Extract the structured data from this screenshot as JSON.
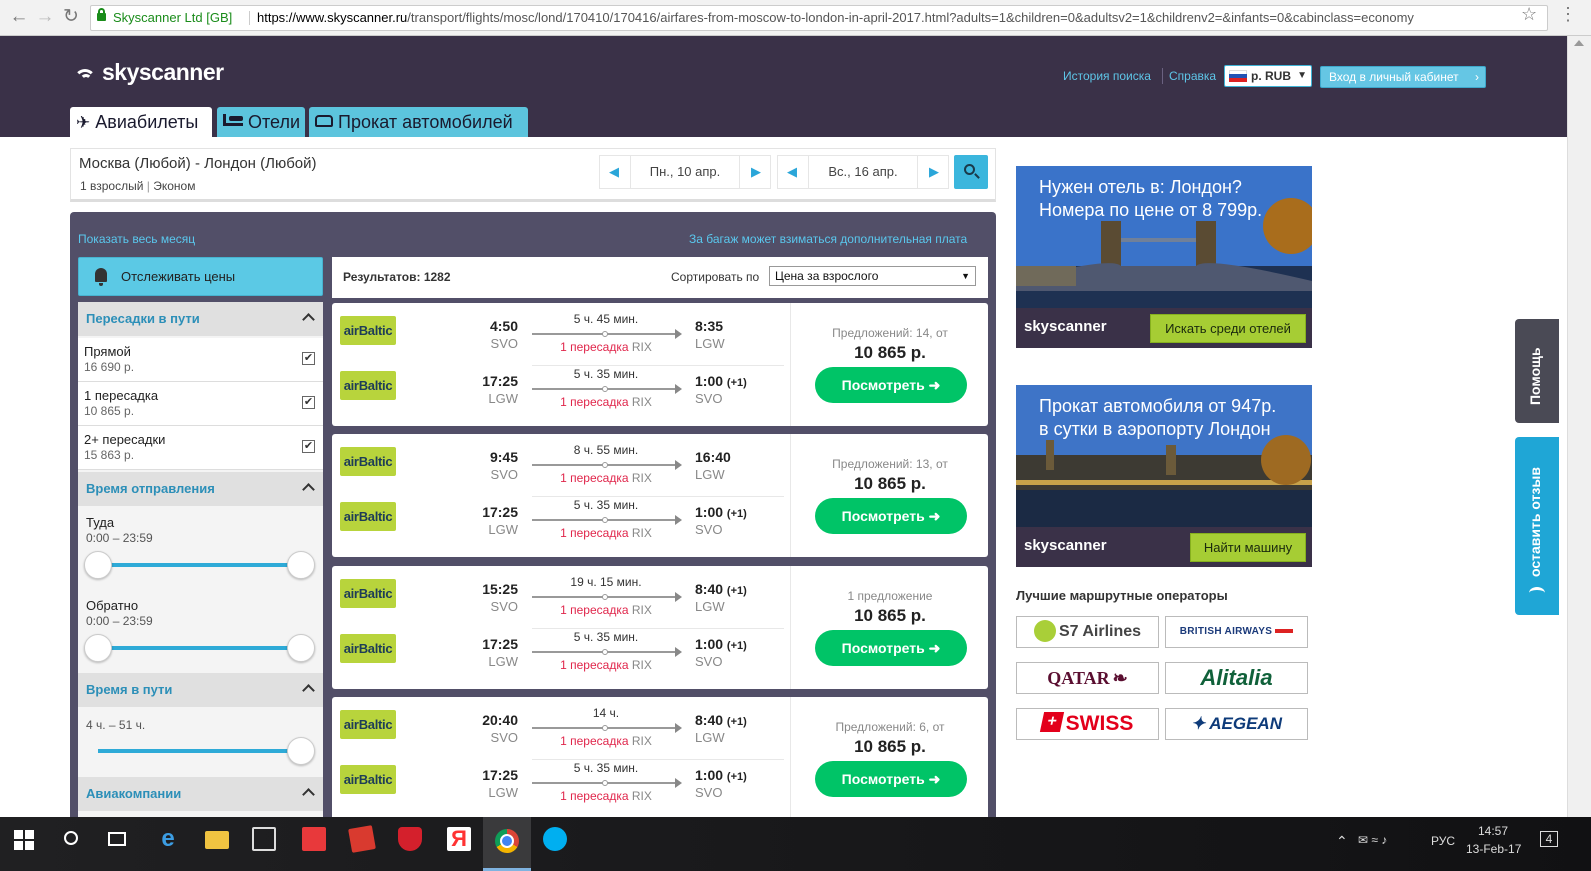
{
  "browser": {
    "site_identity": "Skyscanner Ltd [GB]",
    "url_host": "https://www.skyscanner.ru",
    "url_path": "/transport/flights/mosc/lond/170410/170416/airfares-from-moscow-to-london-in-april-2017.html?adults=1&children=0&adultsv2=1&childrenv2=&infants=0&cabinclass=economy"
  },
  "header": {
    "logo_text": "skyscanner",
    "search_history": "История поиска",
    "help": "Справка",
    "currency": "р. RUB",
    "login": "Вход в личный кабинет"
  },
  "tabs": [
    {
      "label": "Авиабилеты",
      "icon": "plane-icon"
    },
    {
      "label": "Отели",
      "icon": "bed-icon"
    },
    {
      "label": "Прокат автомобилей",
      "icon": "car-icon"
    }
  ],
  "search": {
    "route": "Москва (Любой) - Лондон (Любой)",
    "passengers": "1 взрослый",
    "cabin": "Эконом",
    "depart_date": "Пн., 10 апр.",
    "return_date": "Вс., 16 апр."
  },
  "results_bar": {
    "show_month": "Показать весь месяц",
    "baggage_note": "За багаж может взиматься дополнительная плата",
    "track_prices": "Отслеживать цены",
    "count_label": "Результатов: 1282",
    "sort_label": "Сортировать по",
    "sort_value": "Цена за взрослого"
  },
  "filters": {
    "stops_title": "Пересадки в пути",
    "stops": [
      {
        "name": "Прямой",
        "price": "16 690 р.",
        "checked": true
      },
      {
        "name": "1 пересадка",
        "price": "10 865 р.",
        "checked": true
      },
      {
        "name": "2+ пересадки",
        "price": "15 863 р.",
        "checked": true
      }
    ],
    "depart_title": "Время отправления",
    "outbound_label": "Туда",
    "outbound_range": "0:00 – 23:59",
    "inbound_label": "Обратно",
    "inbound_range": "0:00 – 23:59",
    "duration_title": "Время в пути",
    "duration_range": "4 ч. – 51 ч.",
    "airlines_title": "Авиакомпании"
  },
  "results": [
    {
      "offers": "Предложений: 14, от",
      "price": "10 865 р.",
      "button": "Посмотреть",
      "legs": [
        {
          "airline": "airBaltic",
          "dep_time": "4:50",
          "dep_code": "SVO",
          "duration": "5 ч. 45 мин.",
          "stops": "1 пересадка",
          "via": "RIX",
          "arr_time": "8:35",
          "arr_plus": "",
          "arr_code": "LGW"
        },
        {
          "airline": "airBaltic",
          "dep_time": "17:25",
          "dep_code": "LGW",
          "duration": "5 ч. 35 мин.",
          "stops": "1 пересадка",
          "via": "RIX",
          "arr_time": "1:00",
          "arr_plus": "(+1)",
          "arr_code": "SVO"
        }
      ]
    },
    {
      "offers": "Предложений: 13, от",
      "price": "10 865 р.",
      "button": "Посмотреть",
      "legs": [
        {
          "airline": "airBaltic",
          "dep_time": "9:45",
          "dep_code": "SVO",
          "duration": "8 ч. 55 мин.",
          "stops": "1 пересадка",
          "via": "RIX",
          "arr_time": "16:40",
          "arr_plus": "",
          "arr_code": "LGW"
        },
        {
          "airline": "airBaltic",
          "dep_time": "17:25",
          "dep_code": "LGW",
          "duration": "5 ч. 35 мин.",
          "stops": "1 пересадка",
          "via": "RIX",
          "arr_time": "1:00",
          "arr_plus": "(+1)",
          "arr_code": "SVO"
        }
      ]
    },
    {
      "offers": "1 предложение",
      "price": "10 865 р.",
      "button": "Посмотреть",
      "legs": [
        {
          "airline": "airBaltic",
          "dep_time": "15:25",
          "dep_code": "SVO",
          "duration": "19 ч. 15 мин.",
          "stops": "1 пересадка",
          "via": "RIX",
          "arr_time": "8:40",
          "arr_plus": "(+1)",
          "arr_code": "LGW"
        },
        {
          "airline": "airBaltic",
          "dep_time": "17:25",
          "dep_code": "LGW",
          "duration": "5 ч. 35 мин.",
          "stops": "1 пересадка",
          "via": "RIX",
          "arr_time": "1:00",
          "arr_plus": "(+1)",
          "arr_code": "SVO"
        }
      ]
    },
    {
      "offers": "Предложений: 6, от",
      "price": "10 865 р.",
      "button": "Посмотреть",
      "legs": [
        {
          "airline": "airBaltic",
          "dep_time": "20:40",
          "dep_code": "SVO",
          "duration": "14 ч.",
          "stops": "1 пересадка",
          "via": "RIX",
          "arr_time": "8:40",
          "arr_plus": "(+1)",
          "arr_code": "LGW"
        },
        {
          "airline": "airBaltic",
          "dep_time": "17:25",
          "dep_code": "LGW",
          "duration": "5 ч. 35 мин.",
          "stops": "1 пересадка",
          "via": "RIX",
          "arr_time": "1:00",
          "arr_plus": "(+1)",
          "arr_code": "SVO"
        }
      ]
    }
  ],
  "ads": [
    {
      "text_line1": "Нужен отель в: Лондон?",
      "text_line2": "Номера по цене от 8 799р.",
      "logo": "skyscanner",
      "button": "Искать среди отелей"
    },
    {
      "text_line1": "Прокат автомобиля от 947р.",
      "text_line2": "в сутки в аэропорту Лондон",
      "logo": "skyscanner",
      "button": "Найти машину"
    }
  ],
  "operators": {
    "title": "Лучшие маршрутные операторы",
    "items": [
      "S7 Airlines",
      "BRITISH AIRWAYS",
      "QATAR",
      "Alitalia",
      "SWISS",
      "AEGEAN"
    ]
  },
  "side_tabs": {
    "help": "Помощь",
    "feedback": "оставить отзыв"
  },
  "taskbar": {
    "lang": "РУС",
    "time": "14:57",
    "date": "13-Feb-17",
    "notifications": "4"
  },
  "colors": {
    "header_bg": "#3a3148",
    "accent_blue": "#5cc4dd",
    "button_green": "#00c467",
    "airbaltic_green": "#b8d43c",
    "stops_red": "#e0264b"
  }
}
